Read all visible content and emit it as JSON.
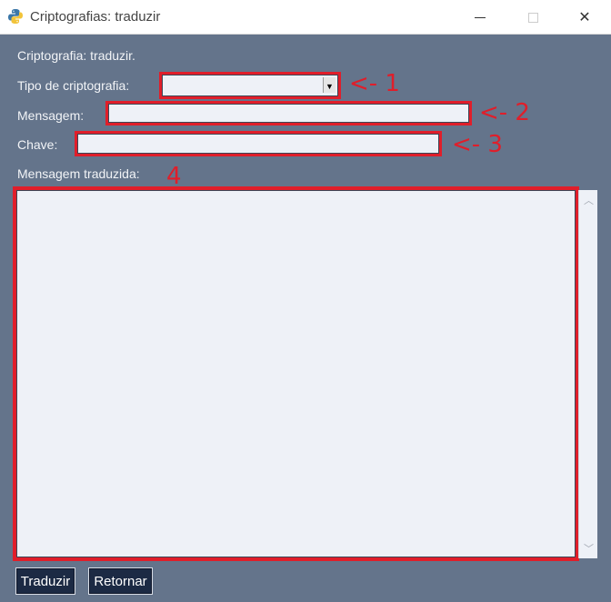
{
  "window": {
    "title": "Criptografias: traduzir",
    "minimize_glyph": "—",
    "close_glyph": "✕"
  },
  "form": {
    "heading": "Criptografia: traduzir.",
    "type_label": "Tipo de criptografia:",
    "type_value": "",
    "message_label": "Mensagem:",
    "message_value": "",
    "key_label": "Chave:",
    "key_value": "",
    "translated_label": "Mensagem traduzida:",
    "translated_value": ""
  },
  "annotations": {
    "a1": "<- 1",
    "a2": "<- 2",
    "a3": "<- 3",
    "a4": "4",
    "color": "#e01e2a"
  },
  "buttons": {
    "translate": "Traduzir",
    "back": "Retornar"
  },
  "icons": {
    "app": "python-logo-icon",
    "combo": "dropdown-arrow-icon",
    "scroll_up": "scroll-up-icon",
    "scroll_down": "scroll-down-icon"
  }
}
